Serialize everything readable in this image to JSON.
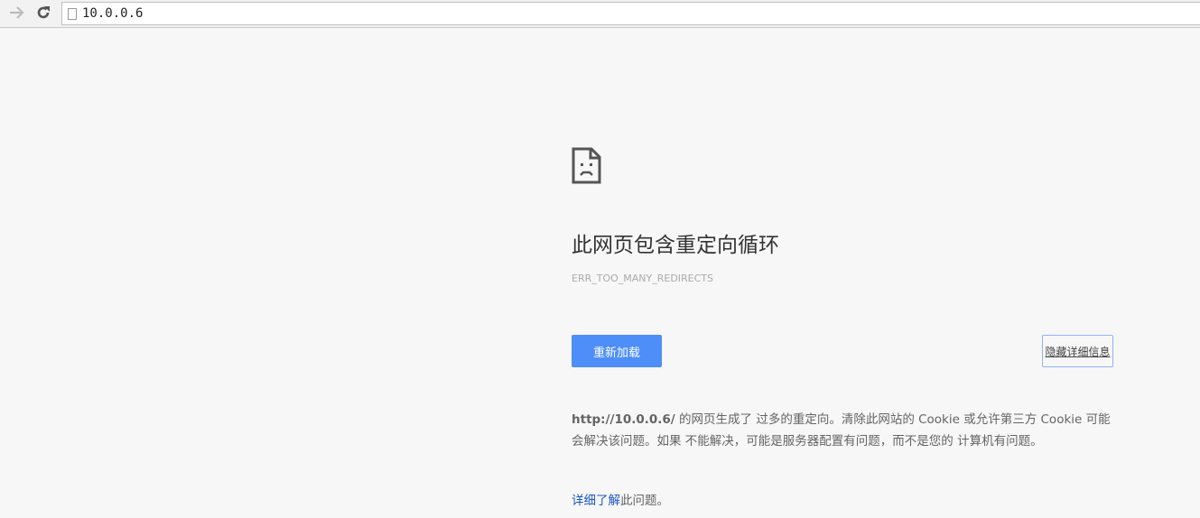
{
  "toolbar": {
    "url": "10.0.0.6",
    "forward_icon": "arrow-right-icon",
    "reload_icon": "reload-icon"
  },
  "error": {
    "title": "此网页包含重定向循环",
    "code": "ERR_TOO_MANY_REDIRECTS",
    "reload_label": "重新加载",
    "details_label": "隐藏详细信息",
    "desc_url": "http://10.0.0.6/",
    "desc_text": " 的网页生成了 过多的重定向。清除此网站的 Cookie 或允许第三方 Cookie 可能会解决该问题。如果 不能解决，可能是服务器配置有问题，而不是您的 计算机有问题。",
    "learn_link": "详细了解",
    "learn_suffix": "此问题。"
  }
}
